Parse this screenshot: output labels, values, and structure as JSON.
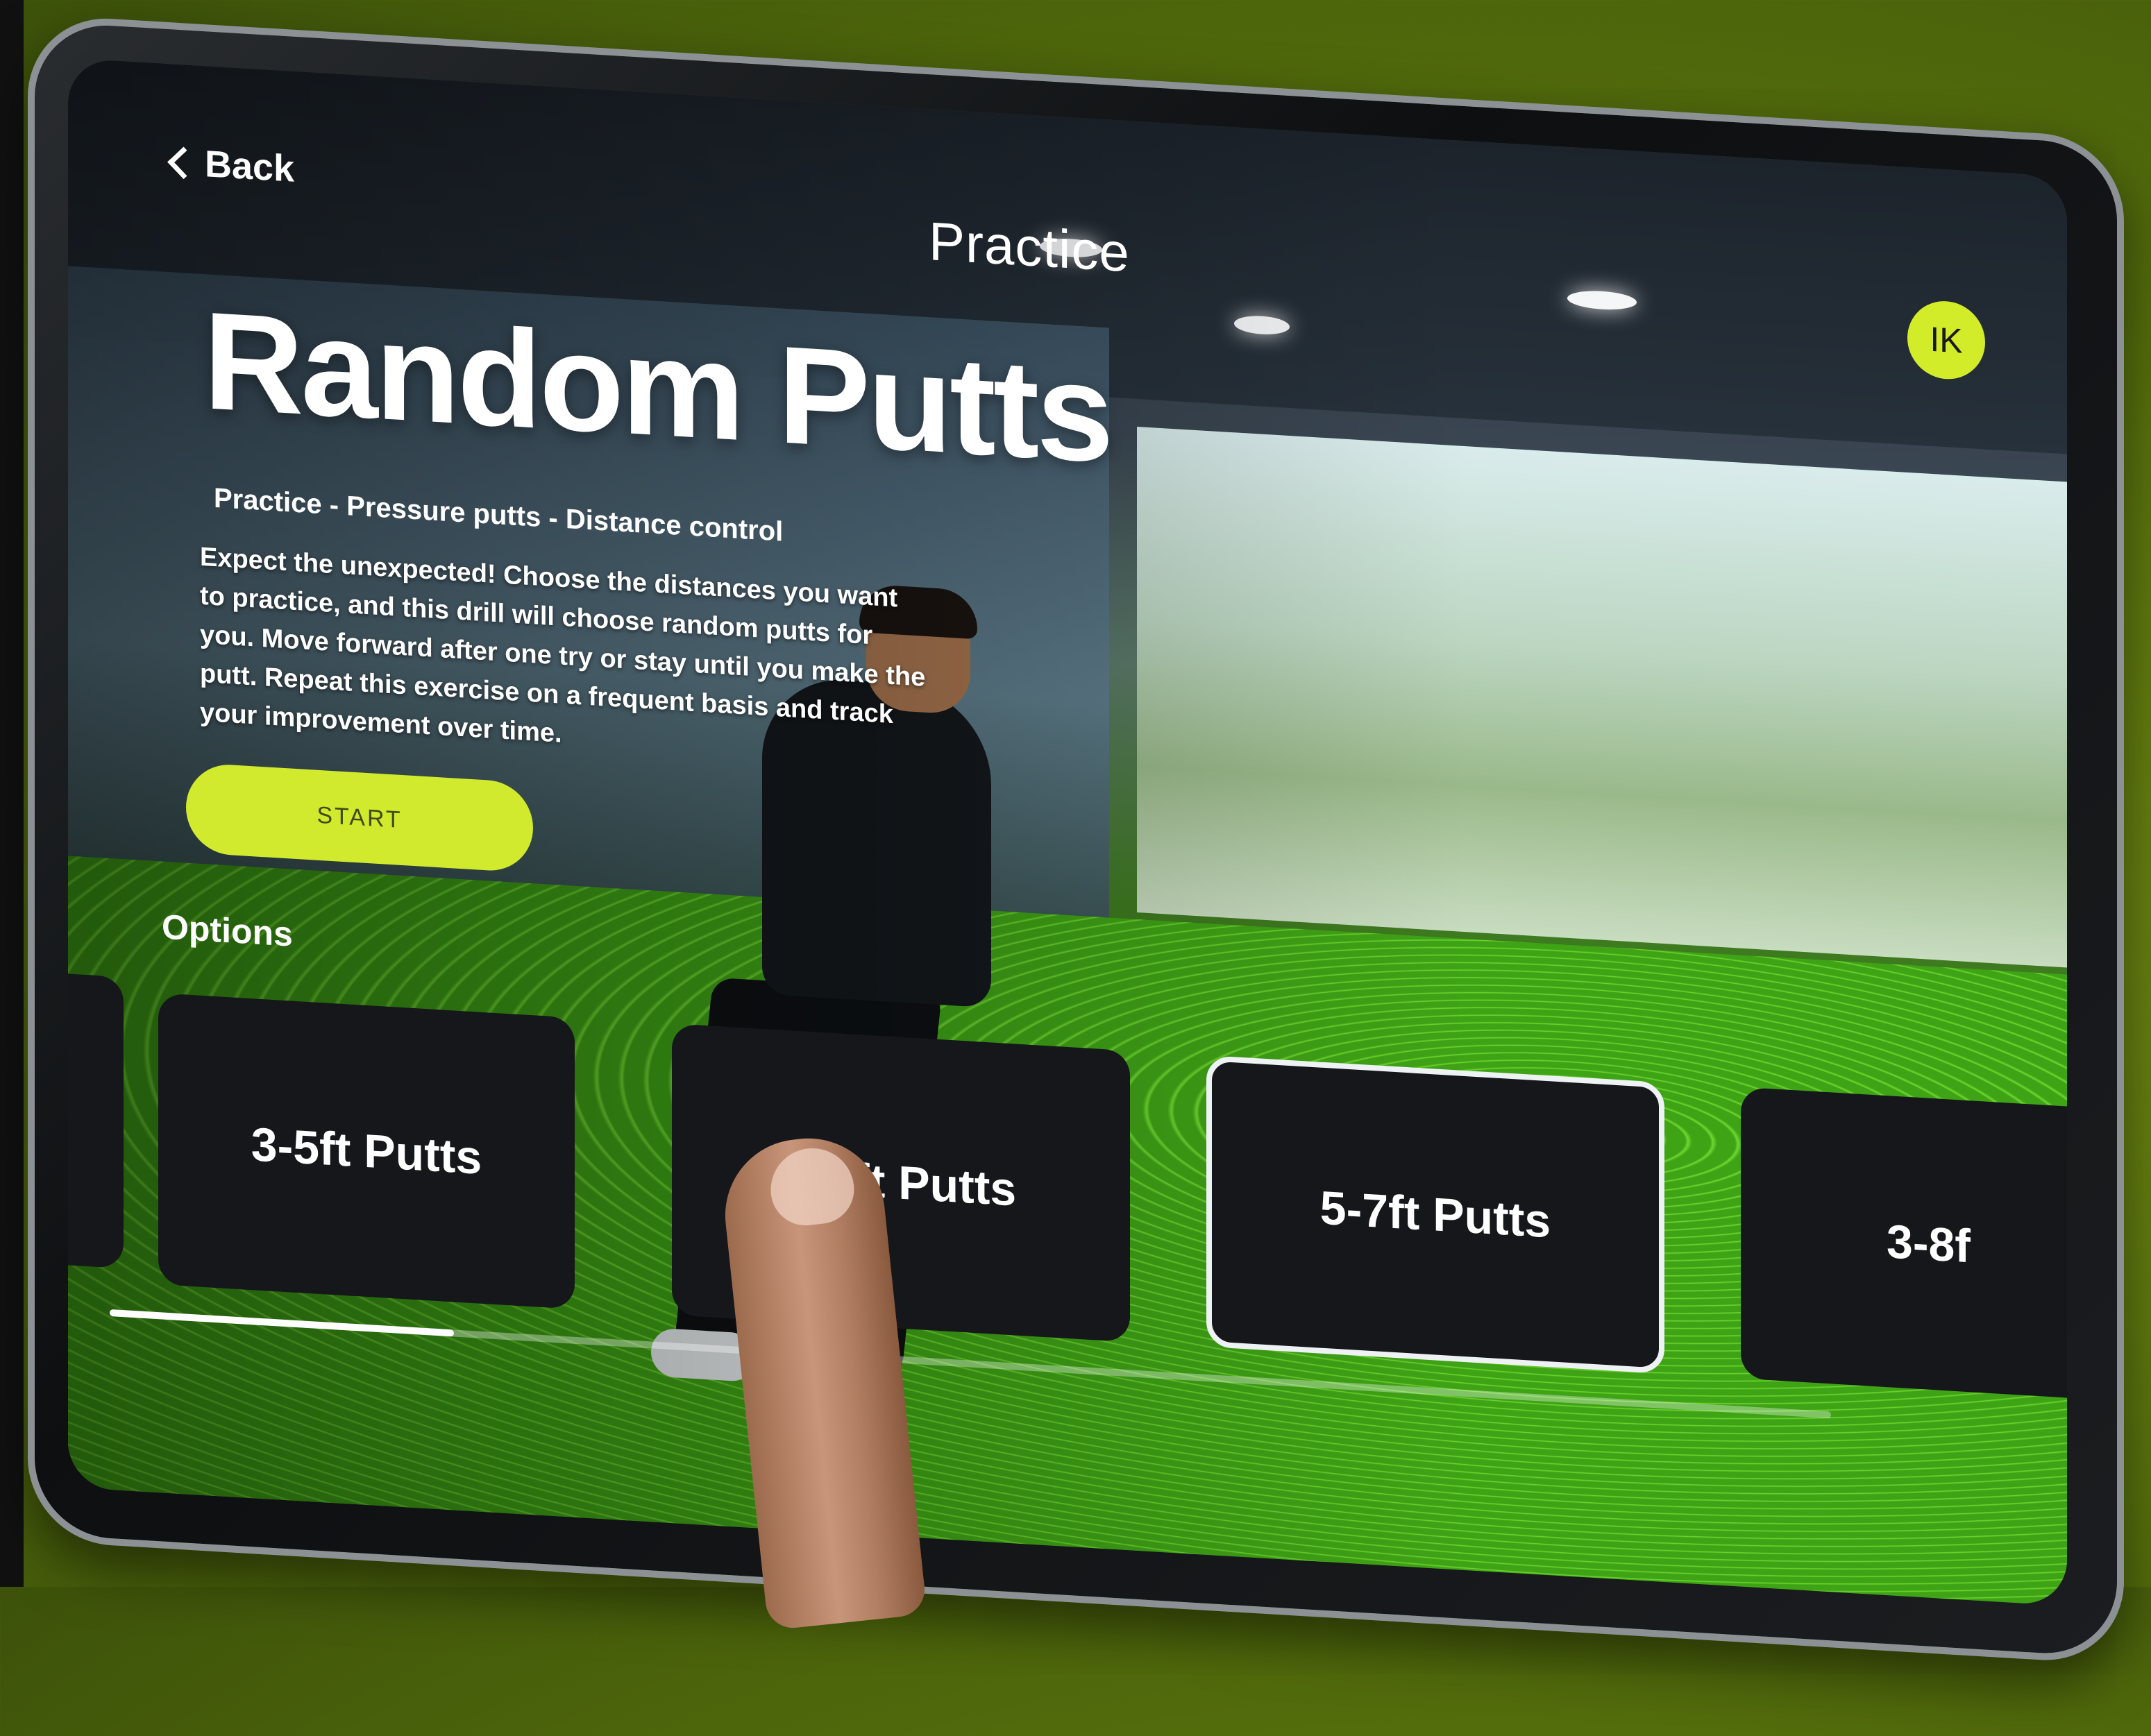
{
  "nav": {
    "back_label": "Back",
    "title": "Practice",
    "avatar_initials": "IK"
  },
  "drill": {
    "title": "Random Putts",
    "tagline": "Practice - Pressure putts - Distance control",
    "description": "Expect the unexpected! Choose the distances you want to practice, and this drill will choose random putts for you. Move forward after one try or stay until you make the putt. Repeat this exercise on a frequent basis and track your improvement over time.",
    "start_label": "START"
  },
  "options": {
    "label": "Options",
    "cards": [
      {
        "label": ""
      },
      {
        "label": "3-5ft Putts"
      },
      {
        "label": "4-6ft Putts"
      },
      {
        "label": "5-7ft Putts"
      },
      {
        "label": "3-8f"
      }
    ],
    "selected_index": 3,
    "scroll_progress": 0.2
  },
  "colors": {
    "accent": "#d2ea2e",
    "card_bg": "#15171a",
    "text": "#ffffff"
  },
  "icons": {
    "back": "chevron-left-icon"
  }
}
